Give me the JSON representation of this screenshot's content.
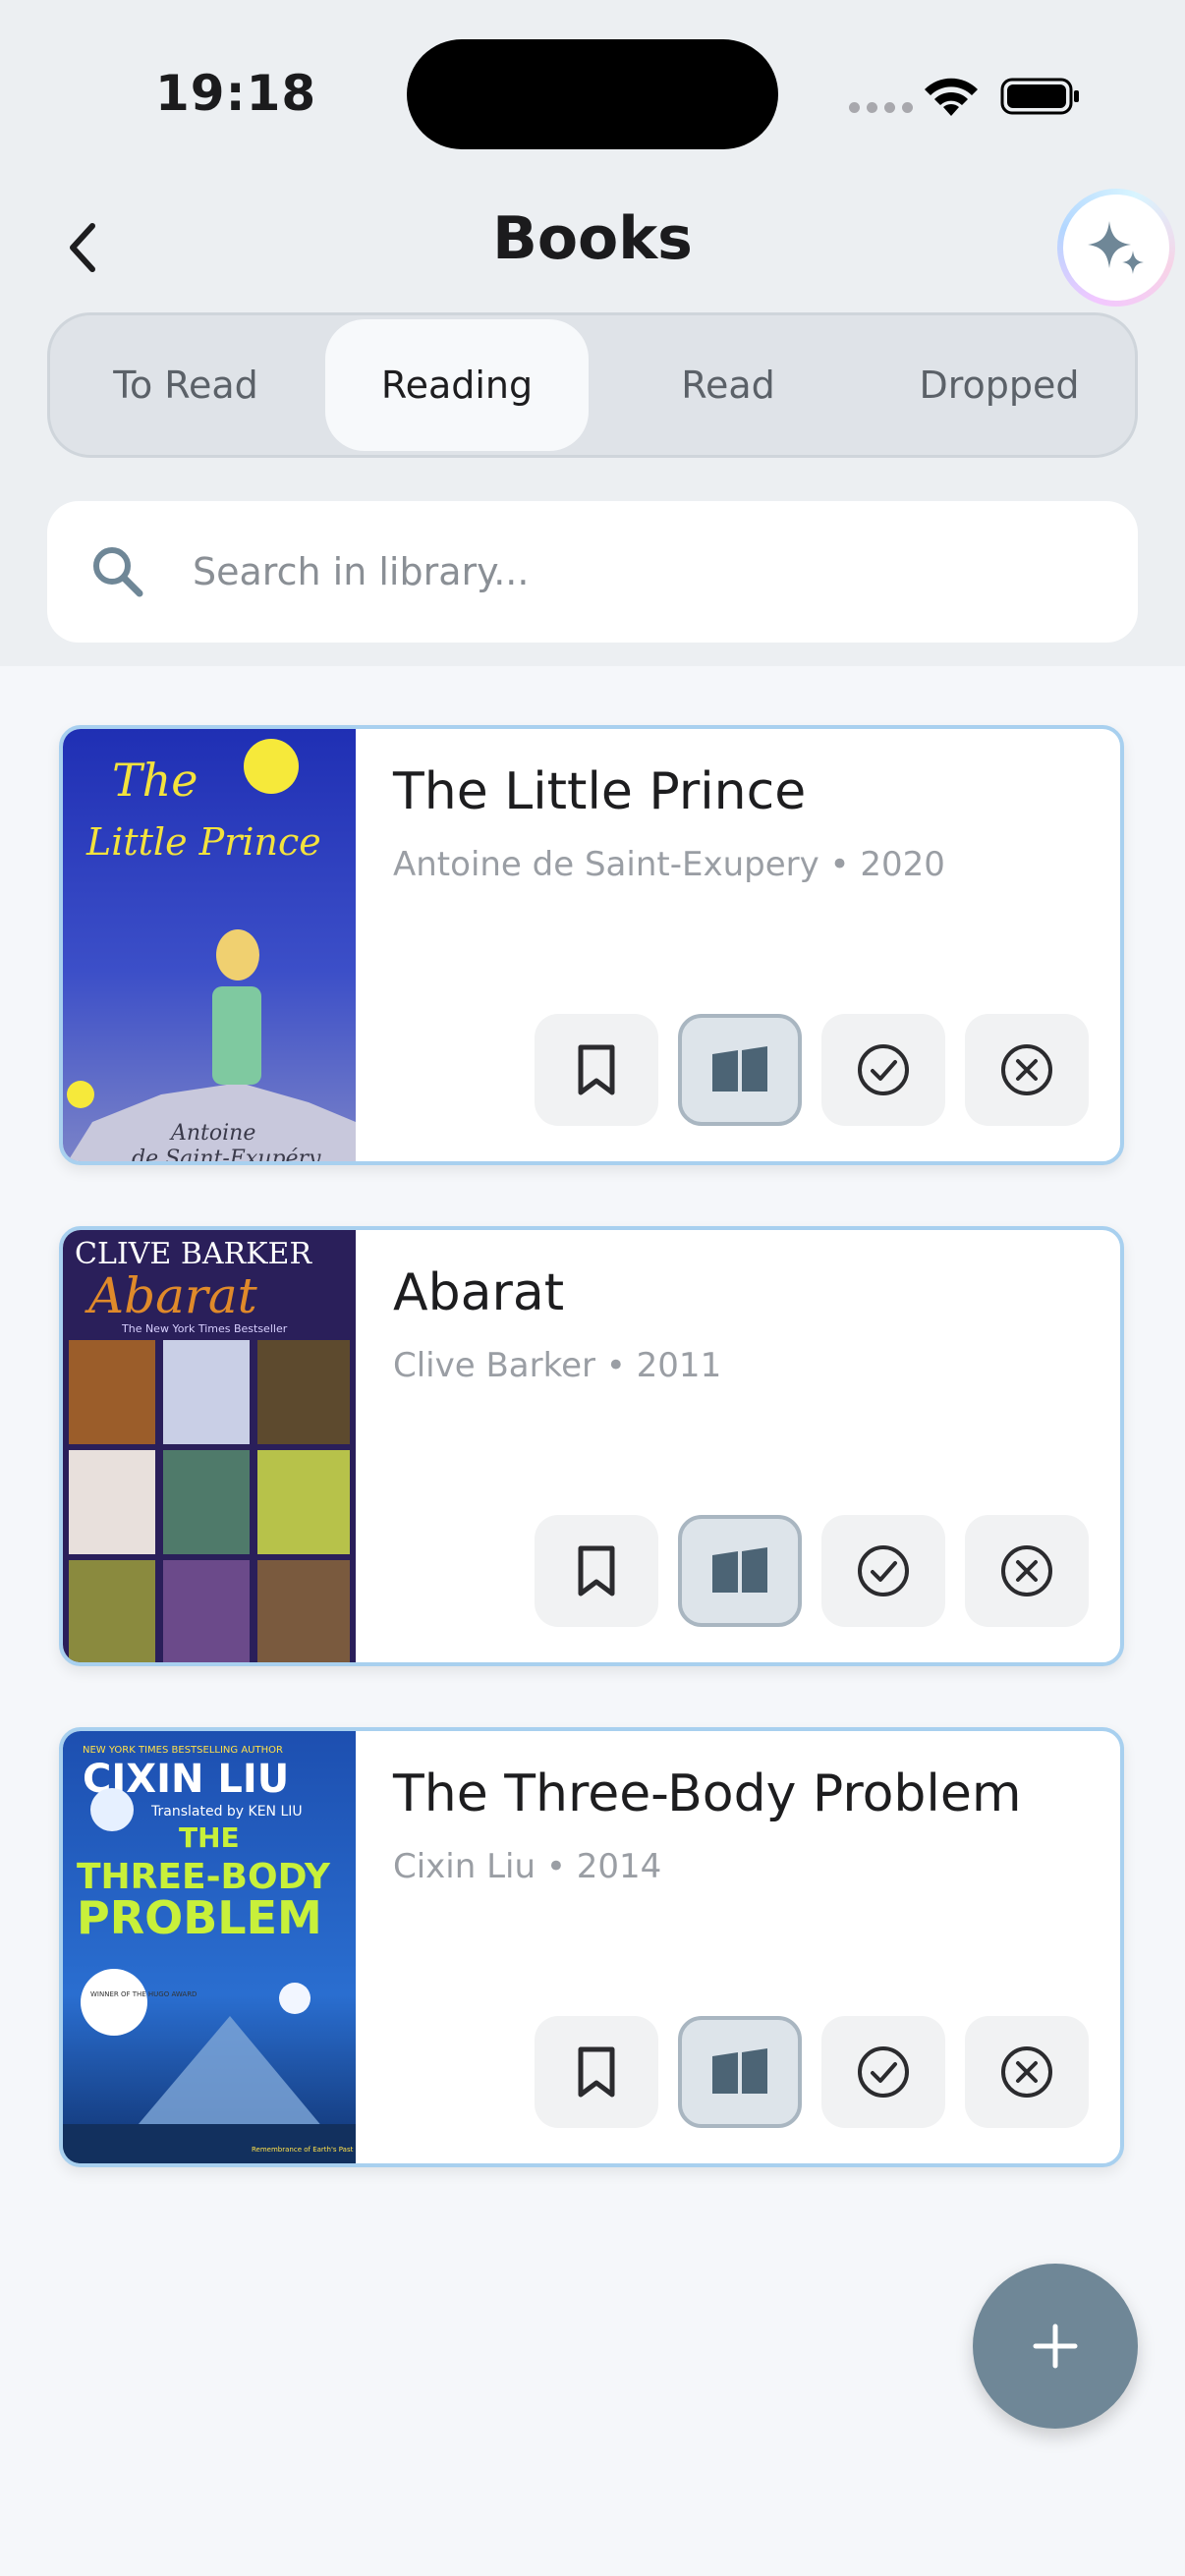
{
  "status": {
    "time": "19:18"
  },
  "header": {
    "title": "Books"
  },
  "tabs": [
    {
      "label": "To Read",
      "active": false
    },
    {
      "label": "Reading",
      "active": true
    },
    {
      "label": "Read",
      "active": false
    },
    {
      "label": "Dropped",
      "active": false
    }
  ],
  "search": {
    "placeholder": "Search in library..."
  },
  "books": [
    {
      "title": "The Little Prince",
      "author": "Antoine de Saint-Exupery",
      "year": "2020",
      "cover_text": [
        "The",
        "Little Prince",
        "Antoine",
        "de Saint-Exupéry"
      ]
    },
    {
      "title": "Abarat",
      "author": "Clive Barker",
      "year": "2011",
      "cover_text": [
        "CLIVE BARKER",
        "Abarat",
        "The New York Times Bestseller"
      ]
    },
    {
      "title": "The Three-Body Problem",
      "author": "Cixin Liu",
      "year": "2014",
      "cover_text": [
        "NEW YORK TIMES BESTSELLING AUTHOR",
        "CIXIN LIU",
        "Translated by KEN LIU",
        "THE",
        "THREE-BODY",
        "PROBLEM",
        "WINNER OF THE HUGO AWARD",
        "Remembrance of Earth's Past"
      ]
    }
  ],
  "book_actions": [
    "bookmark-icon",
    "open-book-icon",
    "check-circle-icon",
    "cancel-circle-icon"
  ],
  "active_action": "open-book-icon",
  "colors": {
    "accent": "#6f8797",
    "card_border": "#a8d0ef",
    "fab": "#6f8797"
  }
}
